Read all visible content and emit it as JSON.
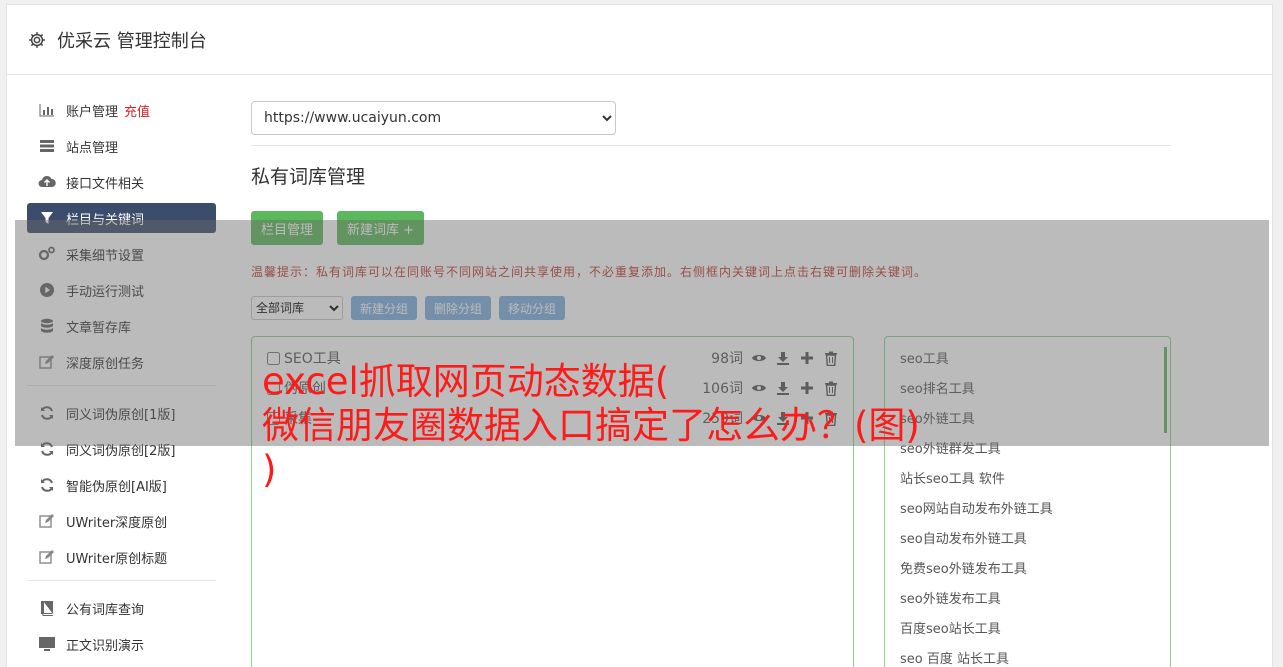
{
  "header": {
    "title": "优采云 管理控制台"
  },
  "sidebar": {
    "items": [
      {
        "label": "账户管理",
        "extra": "充值"
      },
      {
        "label": "站点管理"
      },
      {
        "label": "接口文件相关"
      },
      {
        "label": "栏目与关键词"
      },
      {
        "label": "采集细节设置"
      },
      {
        "label": "手动运行测试"
      },
      {
        "label": "文章暂存库"
      },
      {
        "label": "深度原创任务"
      },
      {
        "label": "同义词伪原创[1版]"
      },
      {
        "label": "同义词伪原创[2版]"
      },
      {
        "label": "智能伪原创[AI版]"
      },
      {
        "label": "UWriter深度原创"
      },
      {
        "label": "UWriter原创标题"
      },
      {
        "label": "公有词库查询"
      },
      {
        "label": "正文识别演示"
      }
    ]
  },
  "main": {
    "site": "https://www.ucaiyun.com",
    "title": "私有词库管理",
    "buttons": {
      "columns": "栏目管理",
      "new_lib": "新建词库 +"
    },
    "tip": "温馨提示：私有词库可以在同账号不同网站之间共享使用，不必重复添加。右侧框内关键词上点击右键可删除关键词。",
    "filter": "全部词库",
    "group_buttons": {
      "new": "新建分组",
      "delete": "删除分组",
      "move": "移动分组"
    },
    "libraries": [
      {
        "name": "SEO工具",
        "count": "98词"
      },
      {
        "name": "伪原创",
        "count": "106词"
      },
      {
        "name": "采集",
        "count": "259词"
      }
    ],
    "keywords": [
      "seo工具",
      "seo排名工具",
      "seo外链工具",
      "seo外链群发工具",
      "站长seo工具 软件",
      "seo网站自动发布外链工具",
      "seo自动发布外链工具",
      "免费seo外链发布工具",
      "seo外链发布工具",
      "百度seo站长工具",
      "seo 百度 站长工具"
    ]
  },
  "overlay_text": {
    "line1": "excel抓取网页动态数据(",
    "line2": "微信朋友圈数据入口搞定了怎么办？(图)",
    "line3": ")"
  },
  "colors": {
    "accent_green": "#5cb85c",
    "active_nav": "#3c4d6b",
    "overlay_text": "#ff1a1a"
  }
}
